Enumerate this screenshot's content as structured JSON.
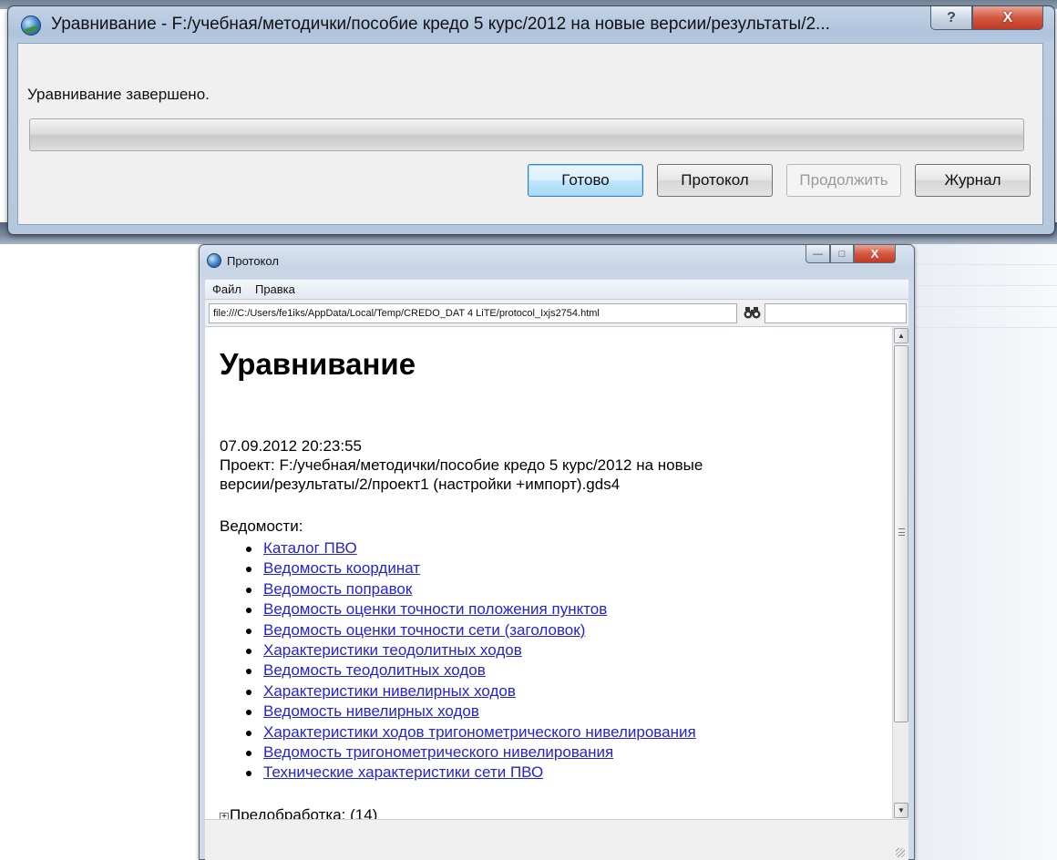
{
  "dialog": {
    "title": "Уравнивание - F:/учебная/методички/пособие кредо 5 курс/2012 на новые версии/результаты/2...",
    "help_label": "?",
    "close_label": "X",
    "status": "Уравнивание завершено.",
    "progress_value": 1.0,
    "buttons": {
      "done": "Готово",
      "protocol": "Протокол",
      "continue": "Продолжить",
      "journal": "Журнал"
    }
  },
  "protocol_window": {
    "title": "Протокол",
    "controls": {
      "minimize": "—",
      "maximize": "□",
      "close": "X"
    },
    "menu": [
      "Файл",
      "Правка"
    ],
    "url": "file:///C:/Users/fe1iks/AppData/Local/Temp/CREDO_DAT 4 LiTE/protocol_Ixjs2754.html",
    "find_icon": "binoculars-icon",
    "find_value": "",
    "content": {
      "heading": "Уравнивание",
      "datetime": "07.09.2012 20:23:55",
      "project_line1": "Проект: F:/учебная/методички/пособие кредо 5 курс/2012 на новые",
      "project_line2": "версии/результаты/2/проект1 (настройки +импорт).gds4",
      "statements_label": "Ведомости:",
      "links": [
        "Каталог ПВО",
        "Ведомость координат",
        "Ведомость поправок",
        "Ведомость оценки точности положения пунктов",
        "Ведомость оценки точности сети (заголовок)",
        "Характеристики теодолитных ходов",
        "Ведомость теодолитных ходов",
        "Характеристики нивелирных ходов",
        "Ведомость нивелирных ходов",
        "Характеристики ходов тригонометрического нивелирования",
        "Ведомость тригонометрического нивелирования",
        "Технические характеристики сети ПВО"
      ],
      "preprocessing": "Предобработка: (14)"
    }
  }
}
